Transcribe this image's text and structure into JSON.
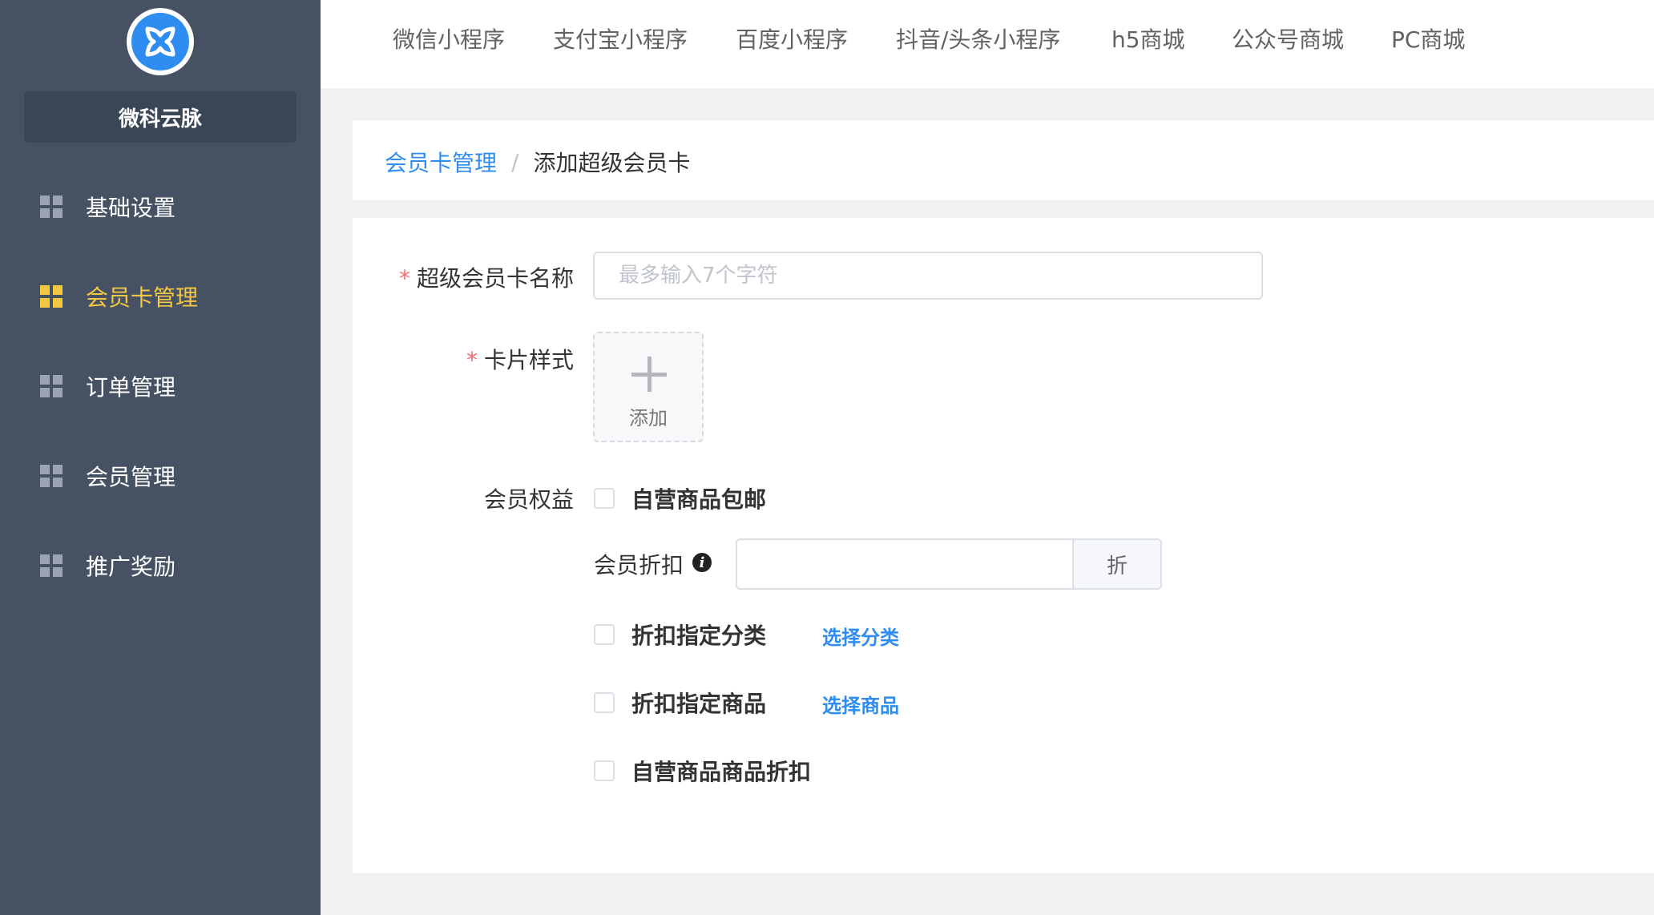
{
  "brand": {
    "name": "微科云脉",
    "logo_icon": "app-logo"
  },
  "sidebar": {
    "items": [
      {
        "label": "基础设置",
        "icon": "grid-icon",
        "active": false
      },
      {
        "label": "会员卡管理",
        "icon": "grid-icon",
        "active": true
      },
      {
        "label": "订单管理",
        "icon": "grid-icon",
        "active": false
      },
      {
        "label": "会员管理",
        "icon": "grid-icon",
        "active": false
      },
      {
        "label": "推广奖励",
        "icon": "grid-icon",
        "active": false
      }
    ]
  },
  "topnav": {
    "tabs": [
      "微信小程序",
      "支付宝小程序",
      "百度小程序",
      "抖音/头条小程序",
      "h5商城",
      "公众号商城",
      "PC商城"
    ]
  },
  "breadcrumb": {
    "parent": "会员卡管理",
    "separator": "/",
    "current": "添加超级会员卡"
  },
  "form": {
    "name": {
      "label": "超级会员卡名称",
      "required_mark": "*",
      "placeholder": "最多输入7个字符",
      "value": ""
    },
    "style": {
      "label": "卡片样式",
      "required_mark": "*",
      "upload_label": "添加"
    },
    "benefits": {
      "label": "会员权益",
      "free_shipping": {
        "label": "自营商品包邮",
        "checked": false
      },
      "discount": {
        "label": "会员折扣",
        "info_icon": "i",
        "value": "",
        "suffix": "折"
      },
      "discount_category": {
        "label": "折扣指定分类",
        "checked": false,
        "action": "选择分类"
      },
      "discount_goods": {
        "label": "折扣指定商品",
        "checked": false,
        "action": "选择商品"
      },
      "self_goods_discount": {
        "label": "自营商品商品折扣",
        "checked": false
      }
    }
  },
  "colors": {
    "sidebar_bg": "#465264",
    "accent": "#2f8cf0",
    "active_menu": "#f5c842",
    "required": "#f56c6c"
  }
}
